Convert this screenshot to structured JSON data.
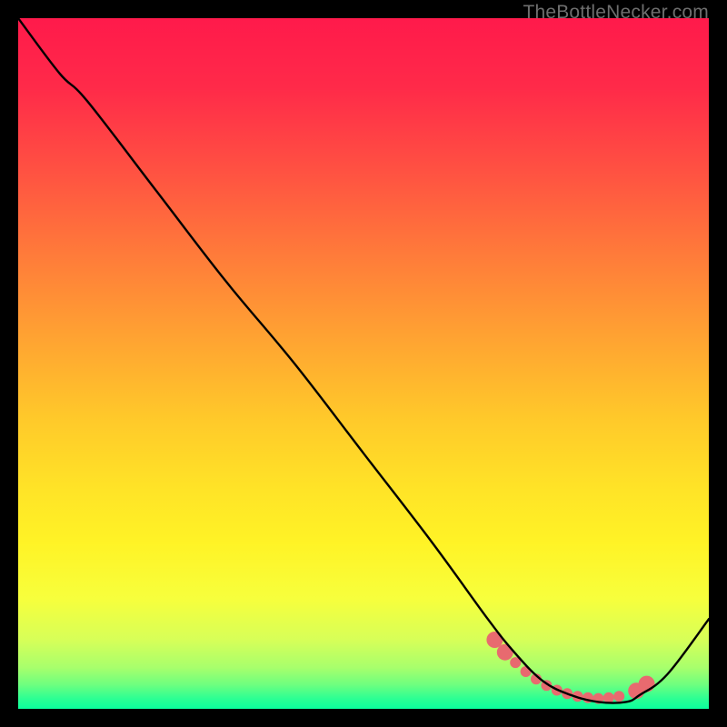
{
  "watermark": "TheBottleNecker.com",
  "gradient": {
    "stops": [
      {
        "offset": 0.0,
        "color": "#ff1a4b"
      },
      {
        "offset": 0.1,
        "color": "#ff2a49"
      },
      {
        "offset": 0.22,
        "color": "#ff5142"
      },
      {
        "offset": 0.34,
        "color": "#ff7a3a"
      },
      {
        "offset": 0.46,
        "color": "#ffa232"
      },
      {
        "offset": 0.58,
        "color": "#ffc92a"
      },
      {
        "offset": 0.68,
        "color": "#ffe327"
      },
      {
        "offset": 0.76,
        "color": "#fff326"
      },
      {
        "offset": 0.84,
        "color": "#f7ff3c"
      },
      {
        "offset": 0.9,
        "color": "#d7ff58"
      },
      {
        "offset": 0.94,
        "color": "#a8ff6c"
      },
      {
        "offset": 0.965,
        "color": "#6eff7f"
      },
      {
        "offset": 0.985,
        "color": "#2dff93"
      },
      {
        "offset": 1.0,
        "color": "#0aff9d"
      }
    ]
  },
  "chart_data": {
    "type": "line",
    "title": "",
    "xlabel": "",
    "ylabel": "",
    "xlim": [
      0,
      100
    ],
    "ylim": [
      0,
      100
    ],
    "series": [
      {
        "name": "bottleneck-curve",
        "x": [
          0,
          6,
          10,
          20,
          30,
          40,
          50,
          60,
          68,
          72,
          76,
          80,
          84,
          88,
          90,
          94,
          100
        ],
        "y": [
          100,
          92,
          88,
          75,
          62,
          50,
          37,
          24,
          13,
          8,
          4,
          2,
          1,
          1,
          2,
          5,
          13
        ]
      }
    ],
    "markers": {
      "name": "highlight-range",
      "x": [
        69,
        70.5,
        72,
        73.5,
        75,
        76.5,
        78,
        79.5,
        81,
        82.5,
        84,
        85.5,
        87,
        89.5,
        91
      ],
      "y": [
        10,
        8.2,
        6.7,
        5.4,
        4.3,
        3.4,
        2.7,
        2.2,
        1.8,
        1.6,
        1.5,
        1.6,
        1.8,
        2.6,
        3.6
      ]
    }
  },
  "curve_style": {
    "stroke": "#000000",
    "stroke_width": 2.4
  },
  "marker_style": {
    "fill": "#e86a6f",
    "radius_small": 6,
    "radius_big": 9
  }
}
